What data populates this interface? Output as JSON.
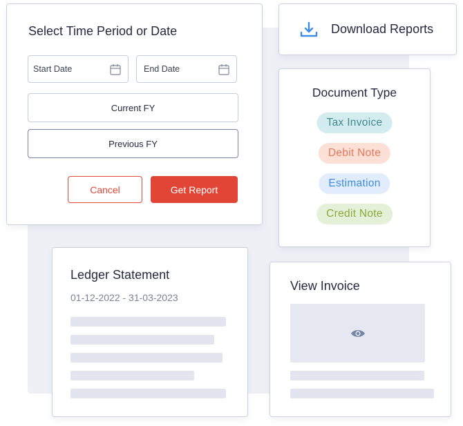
{
  "time_period": {
    "title": "Select Time Period or Date",
    "start_date_placeholder": "Start Date",
    "end_date_placeholder": "End Date",
    "calendar_icon": "calendar-icon",
    "current_fy_label": "Current FY",
    "previous_fy_label": "Previous FY",
    "cancel_label": "Cancel",
    "get_report_label": "Get Report"
  },
  "download": {
    "label": "Download Reports",
    "icon": "download-icon"
  },
  "document_type": {
    "title": "Document Type",
    "chips": [
      {
        "label": "Tax Invoice",
        "color": "#3d8a8e",
        "background": "#d3ecef"
      },
      {
        "label": "Debit Note",
        "color": "#e5775a",
        "background": "#fce0d6"
      },
      {
        "label": "Estimation",
        "color": "#3e8be6",
        "background": "#e1edfd"
      },
      {
        "label": "Credit Note",
        "color": "#86ac3a",
        "background": "#e5f0d9"
      }
    ]
  },
  "ledger": {
    "title": "Ledger Statement",
    "date_range": "01-12-2022 -  31-03-2023"
  },
  "invoice": {
    "title": "View Invoice",
    "preview_icon": "eye-icon"
  },
  "colors": {
    "primary_red": "#e04535",
    "accent_blue": "#3e8be6",
    "text_dark": "#232a3f",
    "panel_bg": "#eef0f6"
  }
}
